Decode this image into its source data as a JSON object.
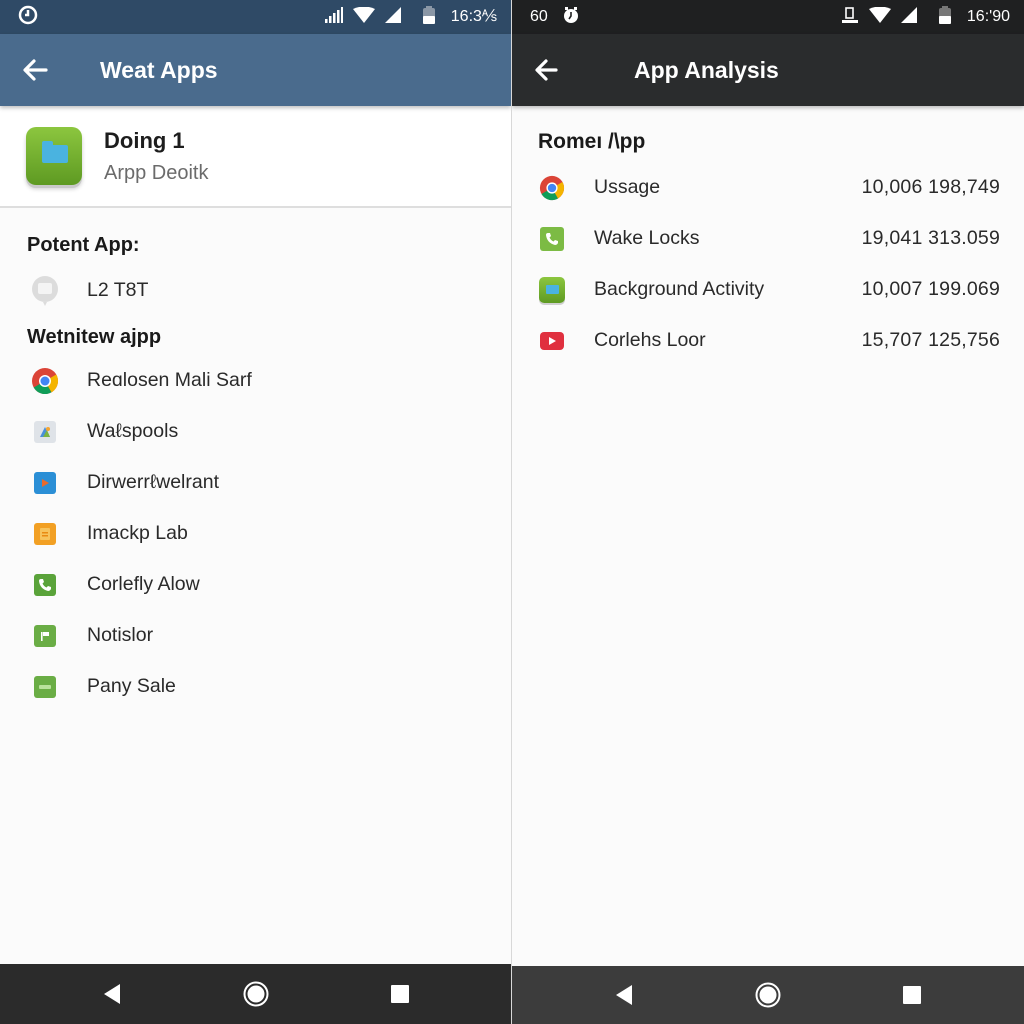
{
  "left": {
    "status": {
      "time": "16:3⅍"
    },
    "appbar": {
      "title": "Weat Apps"
    },
    "header": {
      "name": "Doing 1",
      "subtitle": "Arpp Deoitk"
    },
    "section1": {
      "title": "Potent App:",
      "items": [
        {
          "icon": "chat-bubble-icon",
          "label": "L2   T8T"
        }
      ]
    },
    "section2": {
      "title": "Wetnitew ajpp",
      "items": [
        {
          "icon": "chrome-icon",
          "label": "Reɑlosen Mali Sarf"
        },
        {
          "icon": "wallpaper-icon",
          "label": "Waℓspools"
        },
        {
          "icon": "play-video-icon",
          "label": "Dirwerrℓwelrant"
        },
        {
          "icon": "orange-doc-icon",
          "label": "Imackp Lab"
        },
        {
          "icon": "phone-icon",
          "label": "Corlefly Alow"
        },
        {
          "icon": "flag-icon",
          "label": "Notislor"
        },
        {
          "icon": "green-card-icon",
          "label": "Pany Sale"
        }
      ]
    }
  },
  "right": {
    "status": {
      "left_text": "60",
      "time": "16:'90"
    },
    "appbar": {
      "title": "App Analysis"
    },
    "section": {
      "title": "Romeı /\\pp",
      "rows": [
        {
          "icon": "chrome-icon",
          "label": "Ussage",
          "value": "10,006 198,749"
        },
        {
          "icon": "phone-icon",
          "label": "Wake Locks",
          "value": "19,041 313.059"
        },
        {
          "icon": "folder-app-icon",
          "label": "Background Activity",
          "value": "10,007 199.069"
        },
        {
          "icon": "youtube-icon",
          "label": "Corlehs Loor",
          "value": "15,707 125,756"
        }
      ]
    }
  },
  "colors": {
    "left_appbar": "#4a6b8d",
    "left_statusbar": "#2f4a66",
    "right_appbar": "#2a2c2d",
    "right_statusbar": "#1f2021"
  }
}
